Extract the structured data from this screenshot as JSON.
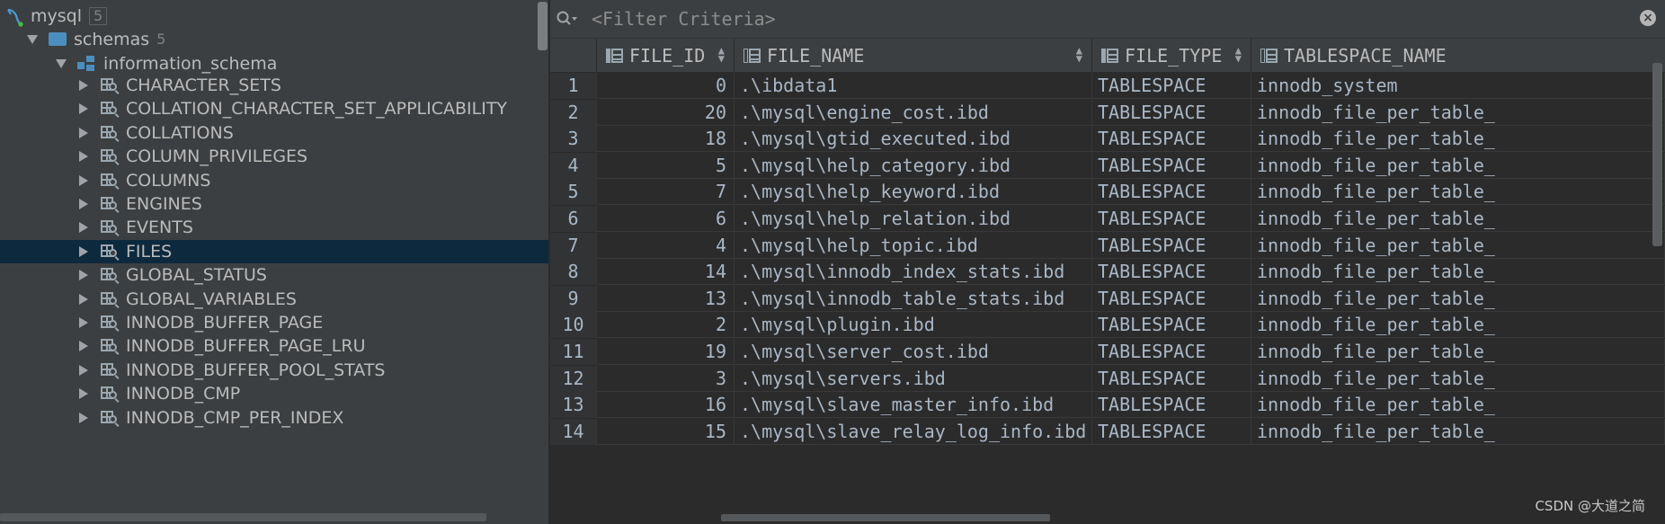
{
  "tree": {
    "root": {
      "label": "mysql",
      "count": "5",
      "icon": "mysql-dolphin-icon"
    },
    "schemas": {
      "label": "schemas",
      "count": "5",
      "icon": "folder-icon"
    },
    "schema": {
      "label": "information_schema",
      "icon": "schema-icon"
    },
    "tables": [
      "CHARACTER_SETS",
      "COLLATION_CHARACTER_SET_APPLICABILITY",
      "COLLATIONS",
      "COLUMN_PRIVILEGES",
      "COLUMNS",
      "ENGINES",
      "EVENTS",
      "FILES",
      "GLOBAL_STATUS",
      "GLOBAL_VARIABLES",
      "INNODB_BUFFER_PAGE",
      "INNODB_BUFFER_PAGE_LRU",
      "INNODB_BUFFER_POOL_STATS",
      "INNODB_CMP",
      "INNODB_CMP_PER_INDEX"
    ],
    "selected": "FILES"
  },
  "filter": {
    "placeholder": "<Filter Criteria>"
  },
  "grid": {
    "columns": [
      "FILE_ID",
      "FILE_NAME",
      "FILE_TYPE",
      "TABLESPACE_NAME"
    ],
    "rows": [
      {
        "n": "1",
        "id": "0",
        "name": ".\\ibdata1",
        "type": "TABLESPACE",
        "ts": "innodb_system"
      },
      {
        "n": "2",
        "id": "20",
        "name": ".\\mysql\\engine_cost.ibd",
        "type": "TABLESPACE",
        "ts": "innodb_file_per_table_"
      },
      {
        "n": "3",
        "id": "18",
        "name": ".\\mysql\\gtid_executed.ibd",
        "type": "TABLESPACE",
        "ts": "innodb_file_per_table_"
      },
      {
        "n": "4",
        "id": "5",
        "name": ".\\mysql\\help_category.ibd",
        "type": "TABLESPACE",
        "ts": "innodb_file_per_table_"
      },
      {
        "n": "5",
        "id": "7",
        "name": ".\\mysql\\help_keyword.ibd",
        "type": "TABLESPACE",
        "ts": "innodb_file_per_table_"
      },
      {
        "n": "6",
        "id": "6",
        "name": ".\\mysql\\help_relation.ibd",
        "type": "TABLESPACE",
        "ts": "innodb_file_per_table_"
      },
      {
        "n": "7",
        "id": "4",
        "name": ".\\mysql\\help_topic.ibd",
        "type": "TABLESPACE",
        "ts": "innodb_file_per_table_"
      },
      {
        "n": "8",
        "id": "14",
        "name": ".\\mysql\\innodb_index_stats.ibd",
        "type": "TABLESPACE",
        "ts": "innodb_file_per_table_"
      },
      {
        "n": "9",
        "id": "13",
        "name": ".\\mysql\\innodb_table_stats.ibd",
        "type": "TABLESPACE",
        "ts": "innodb_file_per_table_"
      },
      {
        "n": "10",
        "id": "2",
        "name": ".\\mysql\\plugin.ibd",
        "type": "TABLESPACE",
        "ts": "innodb_file_per_table_"
      },
      {
        "n": "11",
        "id": "19",
        "name": ".\\mysql\\server_cost.ibd",
        "type": "TABLESPACE",
        "ts": "innodb_file_per_table_"
      },
      {
        "n": "12",
        "id": "3",
        "name": ".\\mysql\\servers.ibd",
        "type": "TABLESPACE",
        "ts": "innodb_file_per_table_"
      },
      {
        "n": "13",
        "id": "16",
        "name": ".\\mysql\\slave_master_info.ibd",
        "type": "TABLESPACE",
        "ts": "innodb_file_per_table_"
      },
      {
        "n": "14",
        "id": "15",
        "name": ".\\mysql\\slave_relay_log_info.ibd",
        "type": "TABLESPACE",
        "ts": "innodb_file_per_table_"
      }
    ]
  },
  "watermark": "CSDN @大道之简"
}
